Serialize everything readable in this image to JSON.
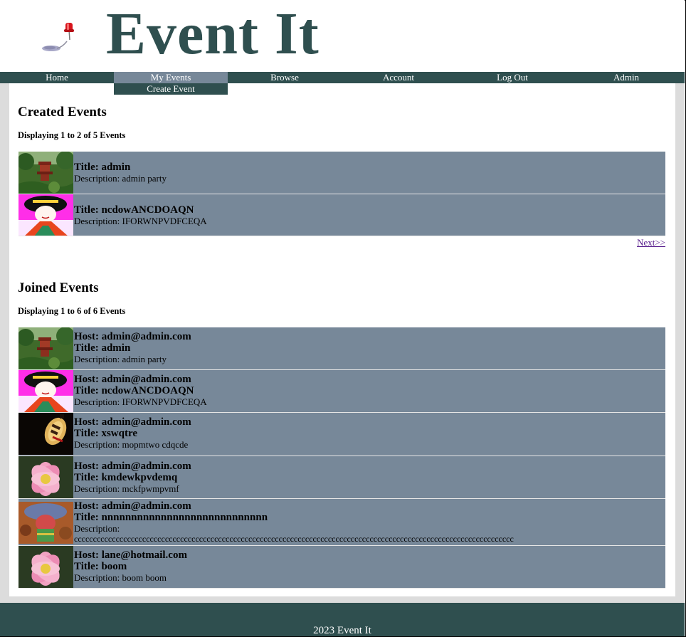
{
  "site": {
    "title": "Event It"
  },
  "nav": {
    "items": [
      {
        "label": "Home"
      },
      {
        "label": "My Events"
      },
      {
        "label": "Browse"
      },
      {
        "label": "Account"
      },
      {
        "label": "Log Out"
      },
      {
        "label": "Admin"
      }
    ],
    "submenu_label": "Create Event"
  },
  "created": {
    "heading": "Created Events",
    "count_text": "Displaying 1 to 2 of 5 Events",
    "events": [
      {
        "title": "Title: admin",
        "description": "Description: admin party",
        "thumb": "pagoda-garden"
      },
      {
        "title": "Title: ncdowANCDOAQN",
        "description": "Description: IFORWNPVDFCEQA",
        "thumb": "geisha-portrait"
      }
    ],
    "next_label": "Next>>"
  },
  "joined": {
    "heading": "Joined Events",
    "count_text": "Displaying 1 to 6 of 6 Events",
    "events": [
      {
        "host": "Host: admin@admin.com",
        "title": "Title: admin",
        "description": "Description: admin party",
        "thumb": "pagoda-garden"
      },
      {
        "host": "Host: admin@admin.com",
        "title": "Title: ncdowANCDOAQN",
        "description": "Description: IFORWNPVDFCEQA",
        "thumb": "geisha-portrait"
      },
      {
        "host": "Host: admin@admin.com",
        "title": "Title: xswqtre",
        "description": "Description: mopmtwo cdqcde",
        "thumb": "paper-lantern"
      },
      {
        "host": "Host: admin@admin.com",
        "title": "Title: kmdewkpvdemq",
        "description": "Description: mckfpwmpvmf",
        "thumb": "lotus-flower"
      },
      {
        "host": "Host: admin@admin.com",
        "title": "Title: nnnnnnnnnnnnnnnnnnnnnnnnnnnn",
        "description": "Description:",
        "description_extra": "cccccccccccccccccccccccccccccccccccccccccccccccccccccccccccccccccccccccccccccccccccccccccccccccccccccccccccccccccccc",
        "thumb": "doll-figure"
      },
      {
        "host": "Host: lane@hotmail.com",
        "title": "Title: boom",
        "description": "Description: boom boom",
        "thumb": "lotus-flower"
      }
    ]
  },
  "footer": {
    "text": "2023 Event It"
  },
  "colors": {
    "primary": "#2f4f4f",
    "row": "#778899",
    "link": "#551a8b"
  }
}
